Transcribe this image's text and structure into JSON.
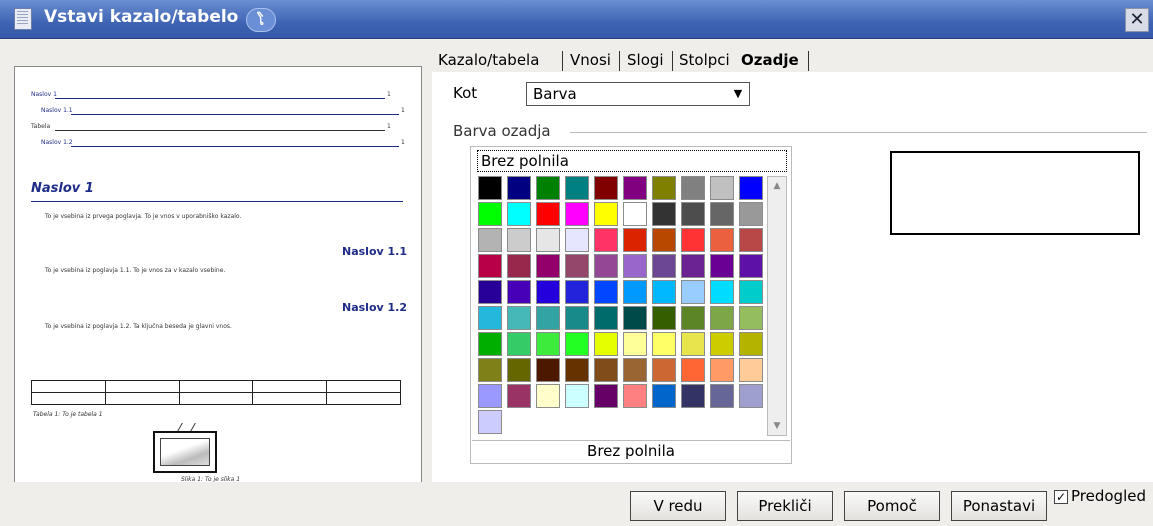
{
  "window": {
    "title": "Vstavi kazalo/tabelo",
    "close_glyph": "✕"
  },
  "tabs": [
    "Kazalo/tabela",
    "Vnosi",
    "Slogi",
    "Stolpci",
    "Ozadje"
  ],
  "active_tab": "Ozadje",
  "background": {
    "kot_label": "Kot",
    "kot_value": "Barva",
    "frame_label": "Barva ozadja",
    "none_option": "Brez polnila",
    "selected_color_name": "Brez polnila"
  },
  "palette": [
    "#000000",
    "#000080",
    "#008000",
    "#008080",
    "#800000",
    "#800080",
    "#808000",
    "#808080",
    "#c0c0c0",
    "#0000ff",
    "#00ff00",
    "#00ffff",
    "#ff0000",
    "#ff00ff",
    "#ffff00",
    "#ffffff",
    "#333333",
    "#4d4d4d",
    "#666666",
    "#999999",
    "#b3b3b3",
    "#cccccc",
    "#e6e6e6",
    "#e6e6ff",
    "#ff3366",
    "#dc2300",
    "#b84700",
    "#ff3333",
    "#eb613d",
    "#b84747",
    "#b80047",
    "#99284d",
    "#94006b",
    "#94476b",
    "#944794",
    "#9966cc",
    "#6b4794",
    "#6b2394",
    "#6b0094",
    "#5e11a6",
    "#280099",
    "#4700b8",
    "#2300dc",
    "#2323dc",
    "#0047ff",
    "#0099ff",
    "#00b8ff",
    "#99ccff",
    "#00dcff",
    "#00cccc",
    "#23b8dc",
    "#47b8b8",
    "#33a3a3",
    "#198a8a",
    "#006b6b",
    "#004a4a",
    "#355e00",
    "#5c8526",
    "#7da647",
    "#94bd5e",
    "#00ae00",
    "#33cc66",
    "#3deb3d",
    "#23ff23",
    "#e6ff00",
    "#ffff99",
    "#ffff66",
    "#e6e64c",
    "#cccc00",
    "#b3b300",
    "#808019",
    "#666600",
    "#4c1900",
    "#663300",
    "#804c19",
    "#996633",
    "#cc6633",
    "#ff6633",
    "#ff9966",
    "#ffcc99",
    "#9999ff",
    "#993366",
    "#ffffcc",
    "#ccffff",
    "#660066",
    "#ff8080",
    "#0066cc",
    "#333366",
    "#666699",
    "#9e9ecf",
    "#ccccff"
  ],
  "preview": {
    "toc": [
      {
        "text": "Naslov 1",
        "page": "1"
      },
      {
        "text": "Naslov 1.1",
        "page": "1"
      },
      {
        "text": "Tabela",
        "page": "1"
      },
      {
        "text": "Naslov 1.2",
        "page": "1"
      }
    ],
    "heading1": "Naslov 1",
    "para1": "To je vsebina iz prvega poglavja. To je vnos v uporabniško kazalo.",
    "heading11": "Naslov 1.1",
    "para2": "To je vsebina iz poglavja 1.1. To je vnos za v kazalo vsebine.",
    "heading12": "Naslov 1.2",
    "para3": "To je vsebina iz poglavja 1.2. Ta ključna beseda je glavni vnos.",
    "table_caption": "Tabela 1: To je tabela 1",
    "image_caption": "Slika 1: To je slika 1"
  },
  "buttons": {
    "ok": "V redu",
    "cancel": "Prekliči",
    "help": "Pomoč",
    "reset": "Ponastavi"
  },
  "preview_checkbox": {
    "label": "Predogled",
    "checked": true
  }
}
